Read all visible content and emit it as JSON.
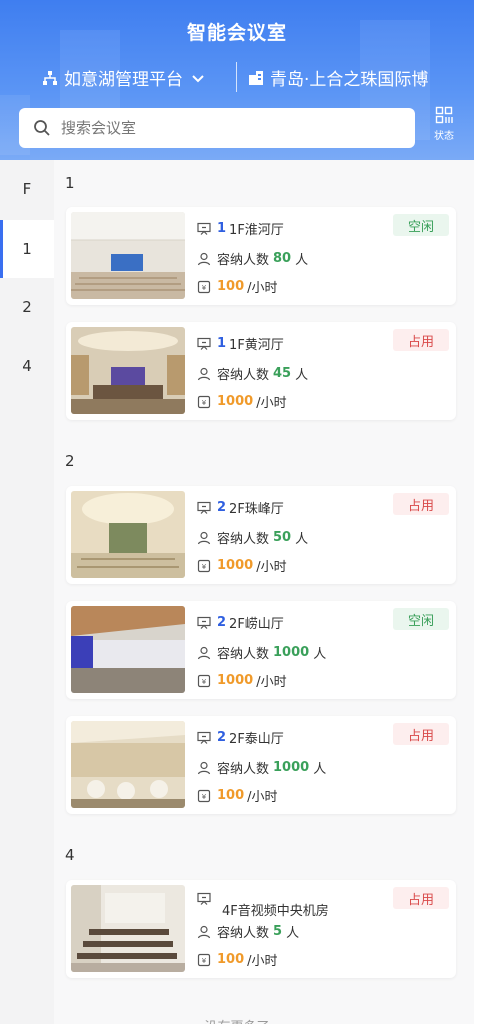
{
  "header": {
    "title": "智能会议室",
    "platform": "如意湖管理平台",
    "location": "青岛·上合之珠国际博",
    "search_placeholder": "搜索会议室",
    "status_label": "状态"
  },
  "sidebar": {
    "items": [
      {
        "label": "F"
      },
      {
        "label": "1",
        "active": true
      },
      {
        "label": "2"
      },
      {
        "label": "4"
      }
    ]
  },
  "groups": [
    {
      "title": "1",
      "rooms": [
        {
          "floor": "1",
          "name": "1F淮河厅",
          "capacity_label": "容纳人数",
          "capacity": "80",
          "capacity_unit": "人",
          "price": "100",
          "price_unit": "/小时",
          "status": "空闲",
          "status_type": "free",
          "thumb": "hall-white"
        },
        {
          "floor": "1",
          "name": "1F黄河厅",
          "capacity_label": "容纳人数",
          "capacity": "45",
          "capacity_unit": "人",
          "price": "1000",
          "price_unit": "/小时",
          "status": "占用",
          "status_type": "busy",
          "thumb": "hall-wood"
        }
      ]
    },
    {
      "title": "2",
      "rooms": [
        {
          "floor": "2",
          "name": "2F珠峰厅",
          "capacity_label": "容纳人数",
          "capacity": "50",
          "capacity_unit": "人",
          "price": "1000",
          "price_unit": "/小时",
          "status": "占用",
          "status_type": "busy",
          "thumb": "hall-gold"
        },
        {
          "floor": "2",
          "name": "2F崂山厅",
          "capacity_label": "容纳人数",
          "capacity": "1000",
          "capacity_unit": "人",
          "price": "1000",
          "price_unit": "/小时",
          "status": "空闲",
          "status_type": "free",
          "thumb": "hall-modern"
        },
        {
          "floor": "2",
          "name": "2F泰山厅",
          "capacity_label": "容纳人数",
          "capacity": "1000",
          "capacity_unit": "人",
          "price": "100",
          "price_unit": "/小时",
          "status": "占用",
          "status_type": "busy",
          "thumb": "hall-banquet"
        }
      ]
    },
    {
      "title": "4",
      "rooms": [
        {
          "floor": "",
          "name": "4F音视频中央机房",
          "capacity_label": "容纳人数",
          "capacity": "5",
          "capacity_unit": "人",
          "price": "100",
          "price_unit": "/小时",
          "status": "占用",
          "status_type": "busy",
          "thumb": "classroom"
        }
      ]
    }
  ],
  "footer": {
    "text": "没有更多了"
  },
  "colors": {
    "accent": "#3a6ff0",
    "free": "#3aa05a",
    "busy": "#d94a4a",
    "price": "#f09a2a"
  }
}
